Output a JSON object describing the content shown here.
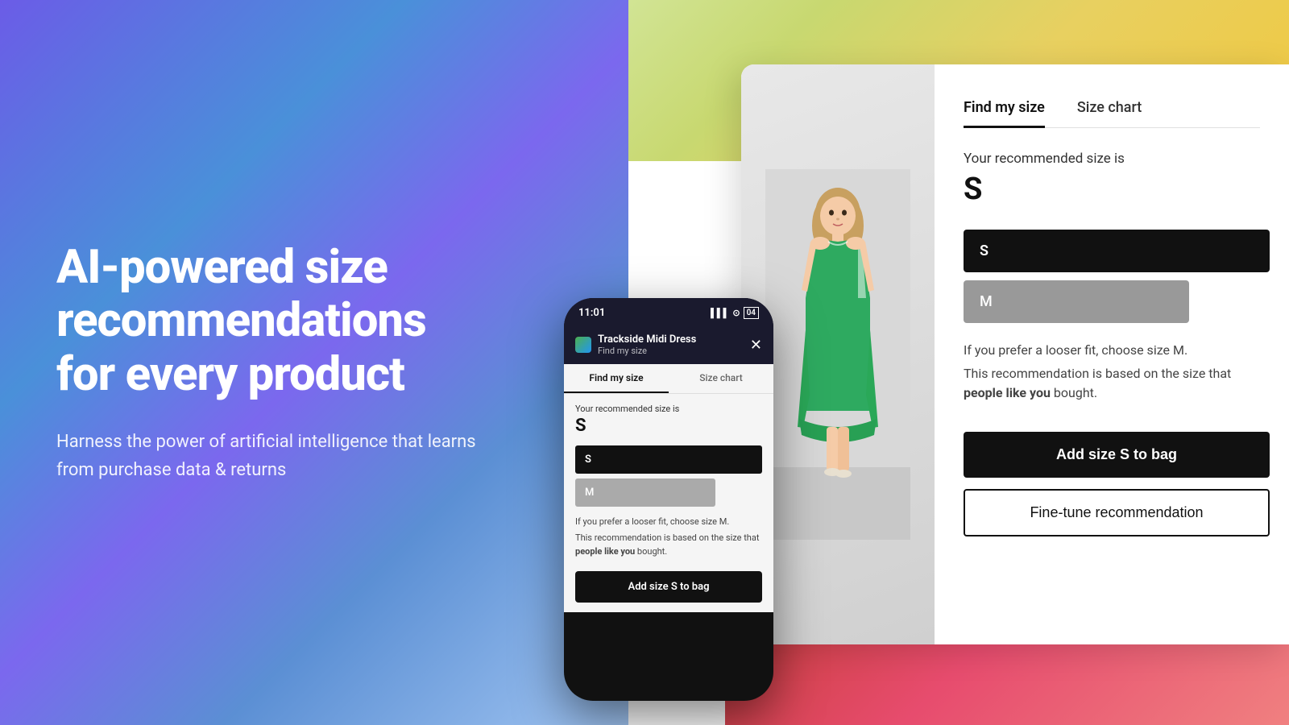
{
  "background": {
    "left_gradient": "linear-gradient(135deg, #6B5CE7 0%, #4A90D9 30%, #7B68EE 50%, #5B8FD4 70%, #A0C4F1 100%)",
    "top_right_gradient": "linear-gradient(135deg, #D4E8A0 0%, #C8D870 30%, #E8D060 60%, #F0C840 100%)",
    "bottom_right_gradient": "linear-gradient(135deg, #C0392B 0%, #E74C6E 50%, #F08080 100%)"
  },
  "hero": {
    "title": "AI-powered size recommendations for every product",
    "subtitle": "Harness the power of artificial intelligence that learns from purchase data & returns"
  },
  "desktop_ui": {
    "tabs": [
      {
        "label": "Find my size",
        "active": true
      },
      {
        "label": "Size chart",
        "active": false
      }
    ],
    "recommended_label": "Your recommended size is",
    "recommended_size": "S",
    "size_options": [
      {
        "label": "S",
        "style": "black"
      },
      {
        "label": "M",
        "style": "gray"
      }
    ],
    "fit_note": "If you prefer a looser fit, choose size M.",
    "recommendation_note_prefix": "This recommendation is based on the size that ",
    "recommendation_note_bold": "people like you",
    "recommendation_note_suffix": " bought.",
    "btn_add_bag": "Add size S to bag",
    "btn_fine_tune": "Fine-tune recommendation"
  },
  "phone_ui": {
    "status_bar": {
      "time": "11:01",
      "signal": "▌▌▌",
      "wifi": "WiFi",
      "battery": "04"
    },
    "app_header": {
      "product_name": "Trackside Midi Dress",
      "subtitle": "Find my size",
      "close_btn": "✕"
    },
    "tabs": [
      {
        "label": "Find my size",
        "active": true
      },
      {
        "label": "Size chart",
        "active": false
      }
    ],
    "recommended_label": "Your recommended size is",
    "recommended_size": "S",
    "size_options": [
      {
        "label": "S",
        "style": "black"
      },
      {
        "label": "M",
        "style": "gray"
      }
    ],
    "fit_note": "If you prefer a looser fit, choose size M.",
    "recommendation_note_prefix": "This recommendation is based on the size that ",
    "recommendation_note_bold": "people like you",
    "recommendation_note_suffix": " bought.",
    "btn_add_bag": "Add size S to bag"
  }
}
